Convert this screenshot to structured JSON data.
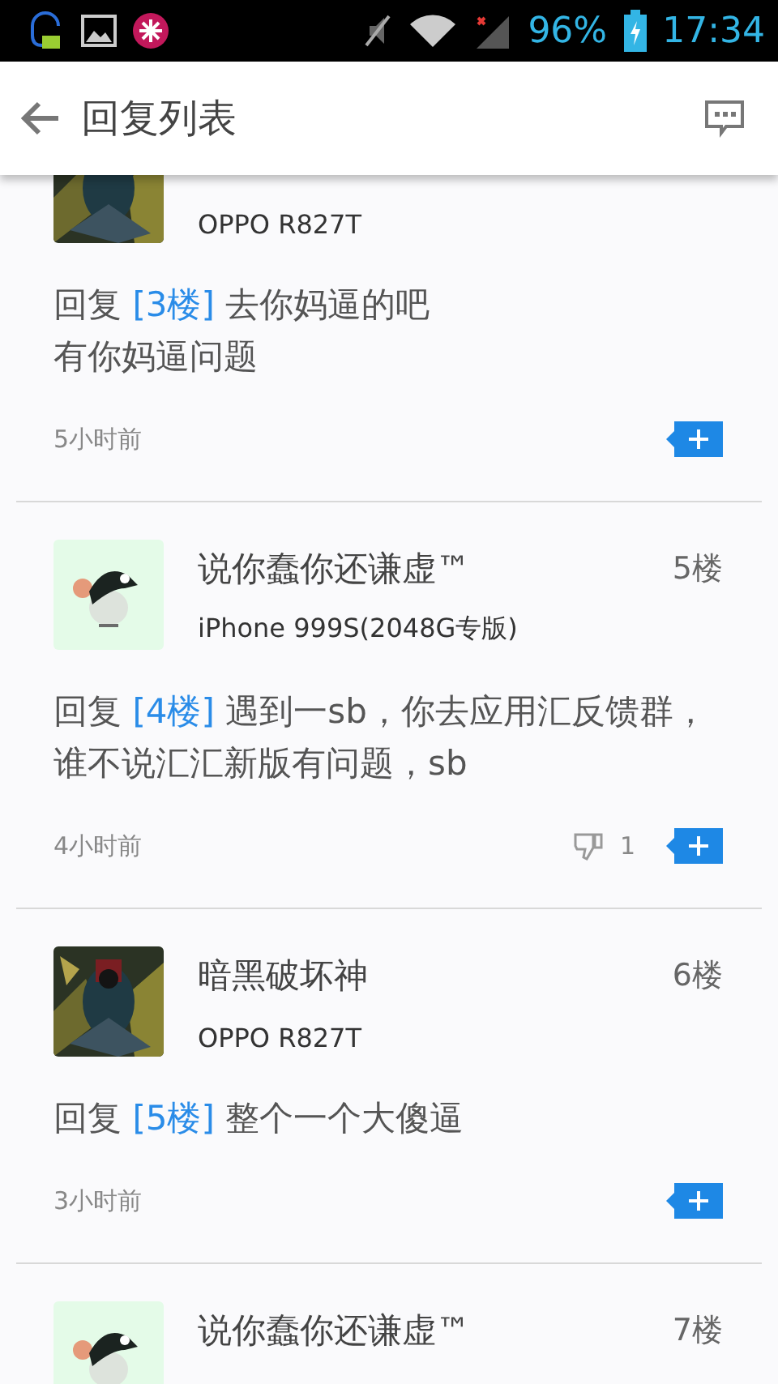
{
  "status_bar": {
    "battery": "96%",
    "time": "17:34"
  },
  "app_bar": {
    "title": "回复列表"
  },
  "replies": [
    {
      "device": "OPPO R827T",
      "reply_prefix": "回复",
      "reply_to": "[3楼]",
      "text": "去你妈逼的吧",
      "text_line_2": "有你妈逼问题",
      "time": "5小时前"
    },
    {
      "name": "说你蠢你还谦虚™",
      "floor": "5楼",
      "device": "iPhone 999S(2048G专版)",
      "reply_prefix": "回复",
      "reply_to": "[4楼]",
      "text": "遇到一sb，你去应用汇反馈群，谁不说汇汇新版有问题，sb",
      "time": "4小时前",
      "dislikes": "1"
    },
    {
      "name": "暗黑破坏神",
      "floor": "6楼",
      "device": "OPPO R827T",
      "reply_prefix": "回复",
      "reply_to": "[5楼]",
      "text": "整个一个大傻逼",
      "time": "3小时前"
    },
    {
      "name": "说你蠢你还谦虚™",
      "floor": "7楼"
    }
  ]
}
